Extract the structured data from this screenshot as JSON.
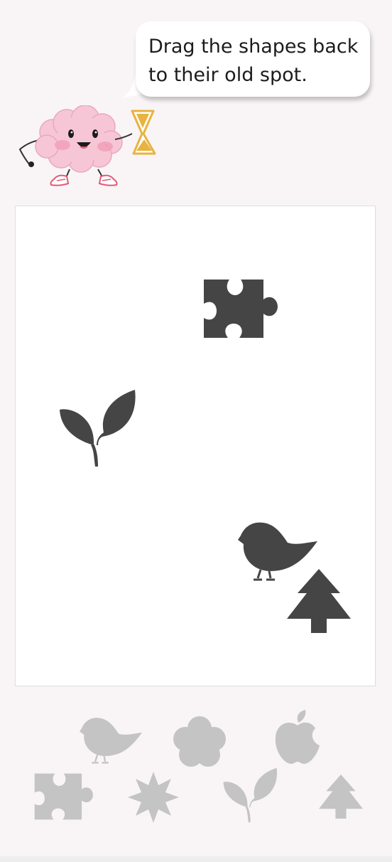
{
  "instruction": "Drag the shapes back to their old spot.",
  "board_pieces": [
    {
      "shape": "puzzle-piece"
    },
    {
      "shape": "leaves"
    },
    {
      "shape": "bird"
    },
    {
      "shape": "tree"
    }
  ],
  "tray_pieces": [
    {
      "shape": "bird"
    },
    {
      "shape": "flower"
    },
    {
      "shape": "apple"
    },
    {
      "shape": "puzzle-piece"
    },
    {
      "shape": "star"
    },
    {
      "shape": "leaves"
    },
    {
      "shape": "tree"
    }
  ],
  "colors": {
    "background": "#f9f5f6",
    "board": "#ffffff",
    "piece_dark": "#454545",
    "piece_light": "#c4c4c4",
    "mascot_pink": "#f7c6d6",
    "hourglass_gold": "#e8b340"
  }
}
